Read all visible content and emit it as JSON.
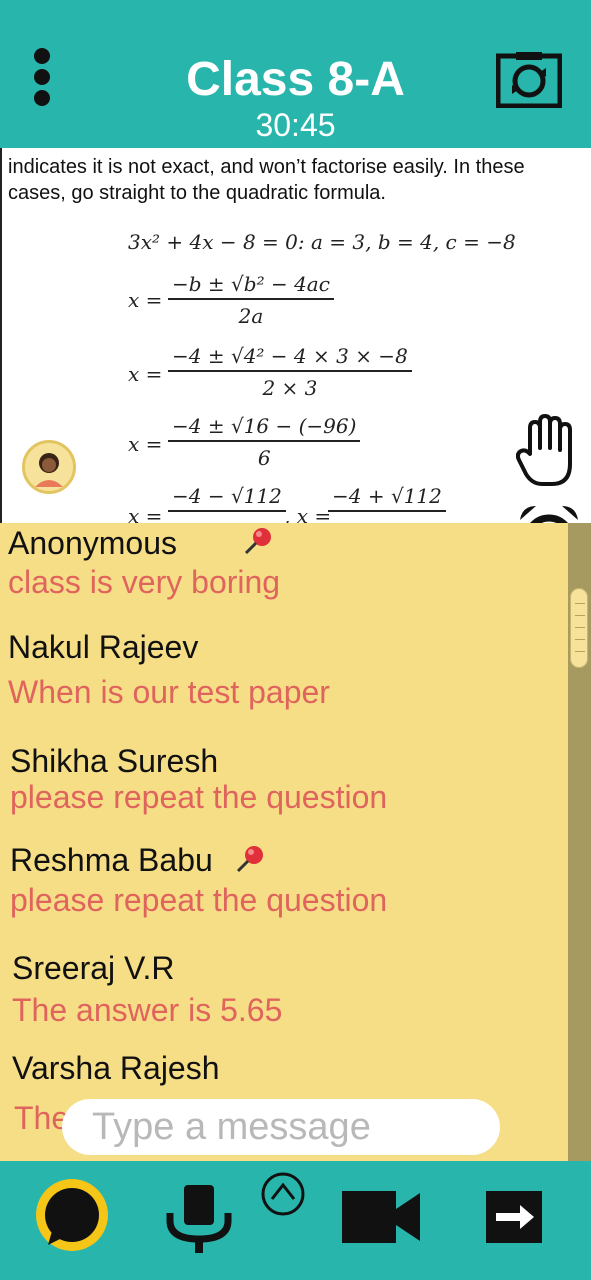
{
  "header": {
    "title": "Class 8-A",
    "timer": "30:45"
  },
  "board": {
    "line1": "indicates it is not exact, and won’t factorise easily.  In these",
    "line2": "cases, go straight to the quadratic formula.",
    "eq1": "3x² + 4x − 8 = 0: a = 3, b = 4, c = −8",
    "eq2_lhs": "x =",
    "eq2_num": "−b ± √b² − 4ac",
    "eq2_den": "2a",
    "eq3_lhs": "x =",
    "eq3_num": "−4 ± √4² − 4 × 3 × −8",
    "eq3_den": "2 × 3",
    "eq4_lhs": "x =",
    "eq4_num": "−4 ± √16 − (−96)",
    "eq4_den": "6",
    "eq5_lhs": "x =",
    "eq5_num_a": "−4 − √112",
    "eq5_mid": ", x =",
    "eq5_num_b": "−4 + √112"
  },
  "chat": {
    "messages": [
      {
        "name": "Anonymous",
        "text": "class is very boring",
        "pinned": true
      },
      {
        "name": "Nakul Rajeev",
        "text": "When is our test paper",
        "pinned": false
      },
      {
        "name": "Shikha Suresh",
        "text": "please repeat the question",
        "pinned": false
      },
      {
        "name": "Reshma Babu",
        "text": "please repeat the question",
        "pinned": true
      },
      {
        "name": "Sreeraj V.R",
        "text": "The answer is 5.65",
        "pinned": false
      },
      {
        "name": "Varsha Rajesh",
        "text": "The",
        "pinned": false
      }
    ],
    "input_placeholder": "Type a message"
  },
  "colors": {
    "header": "#27b5ac",
    "chat_bg": "#f6de86",
    "message_text": "#e0645e",
    "chat_button": "#f5c518"
  },
  "icons": [
    "menu-icon",
    "camera-switch-icon",
    "raise-hand-icon",
    "alarm-clock-icon",
    "avatar-icon",
    "pin-icon",
    "chat-icon",
    "microphone-icon",
    "expand-up-icon",
    "video-camera-icon",
    "exit-icon"
  ]
}
